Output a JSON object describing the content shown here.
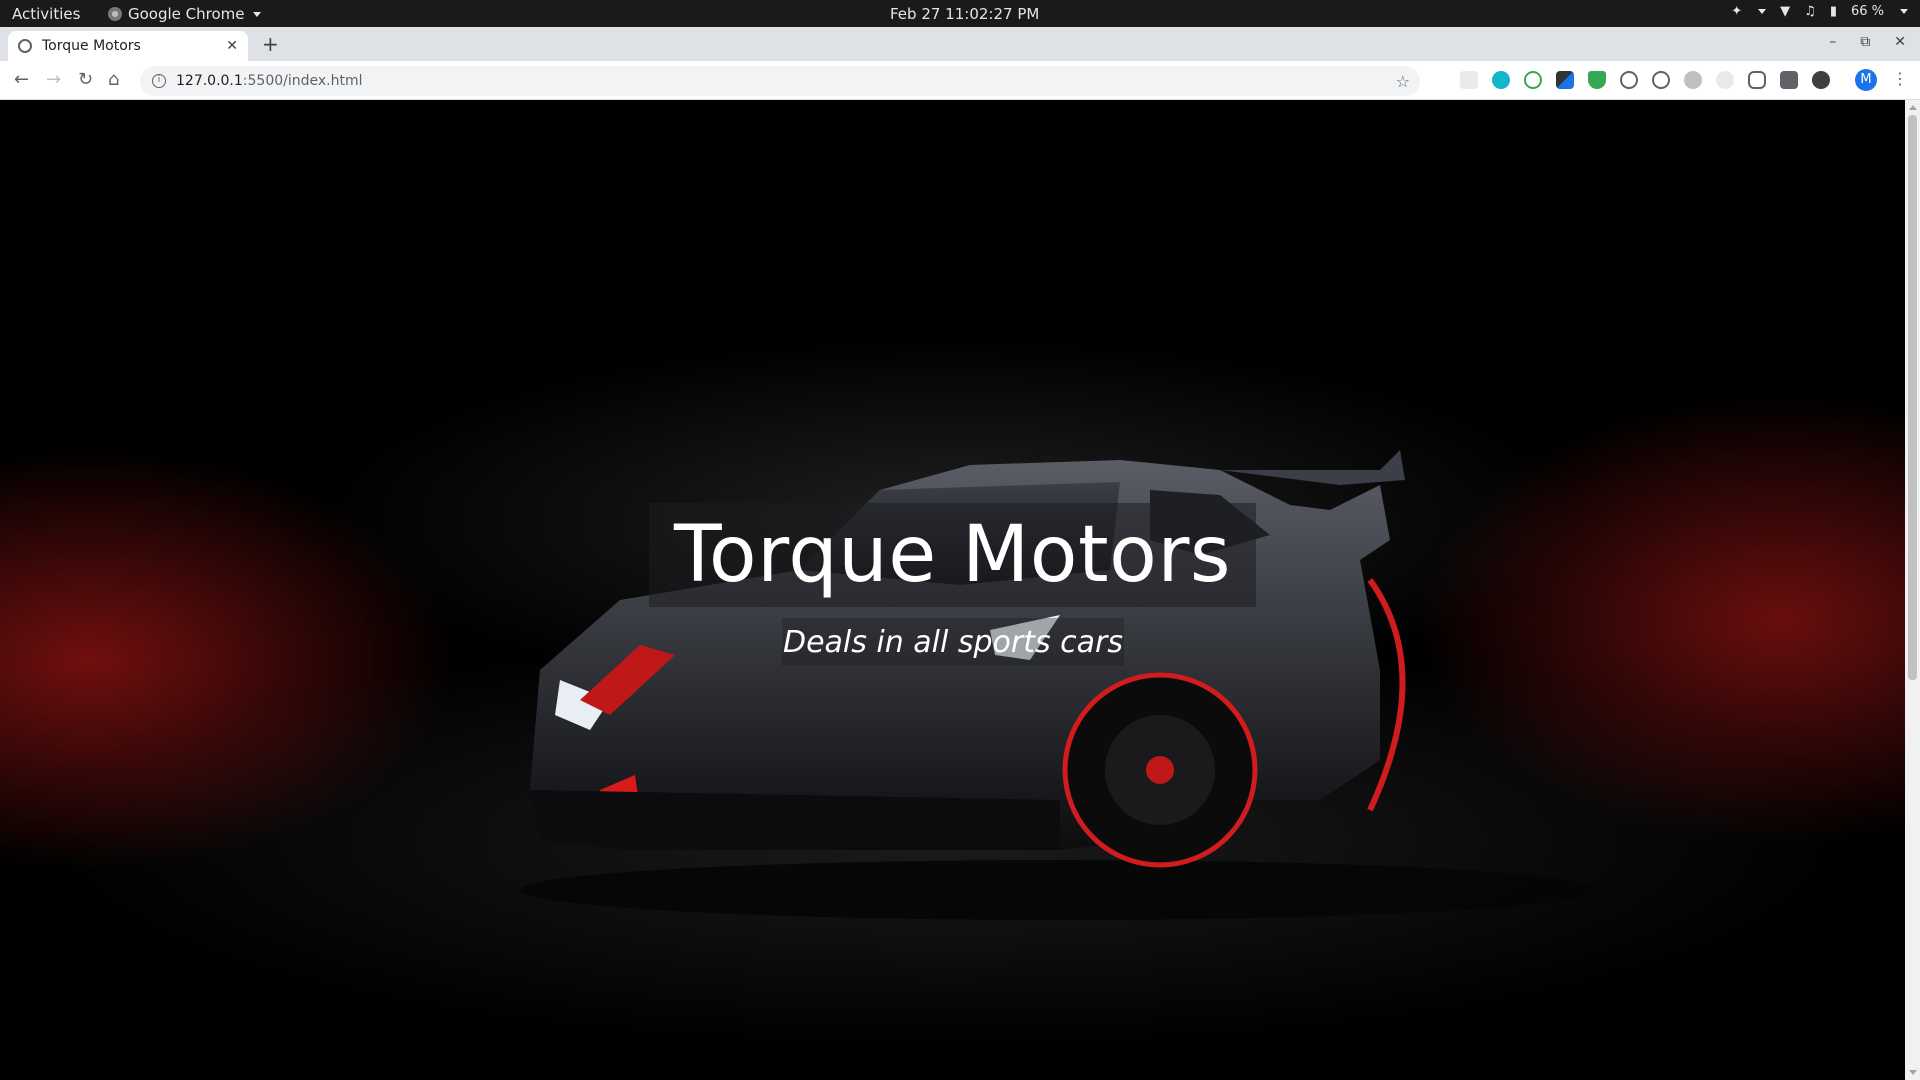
{
  "system_bar": {
    "activities": "Activities",
    "app_name": "Google Chrome",
    "clock": "Feb 27  11:02:27 PM",
    "battery": "66 %"
  },
  "browser": {
    "tab_title": "Torque Motors",
    "url_host": "127.0.0.1",
    "url_path": ":5500/index.html",
    "profile_initial": "M"
  },
  "hero": {
    "title": "Torque Motors",
    "subtitle": "Deals in all sports cars"
  }
}
